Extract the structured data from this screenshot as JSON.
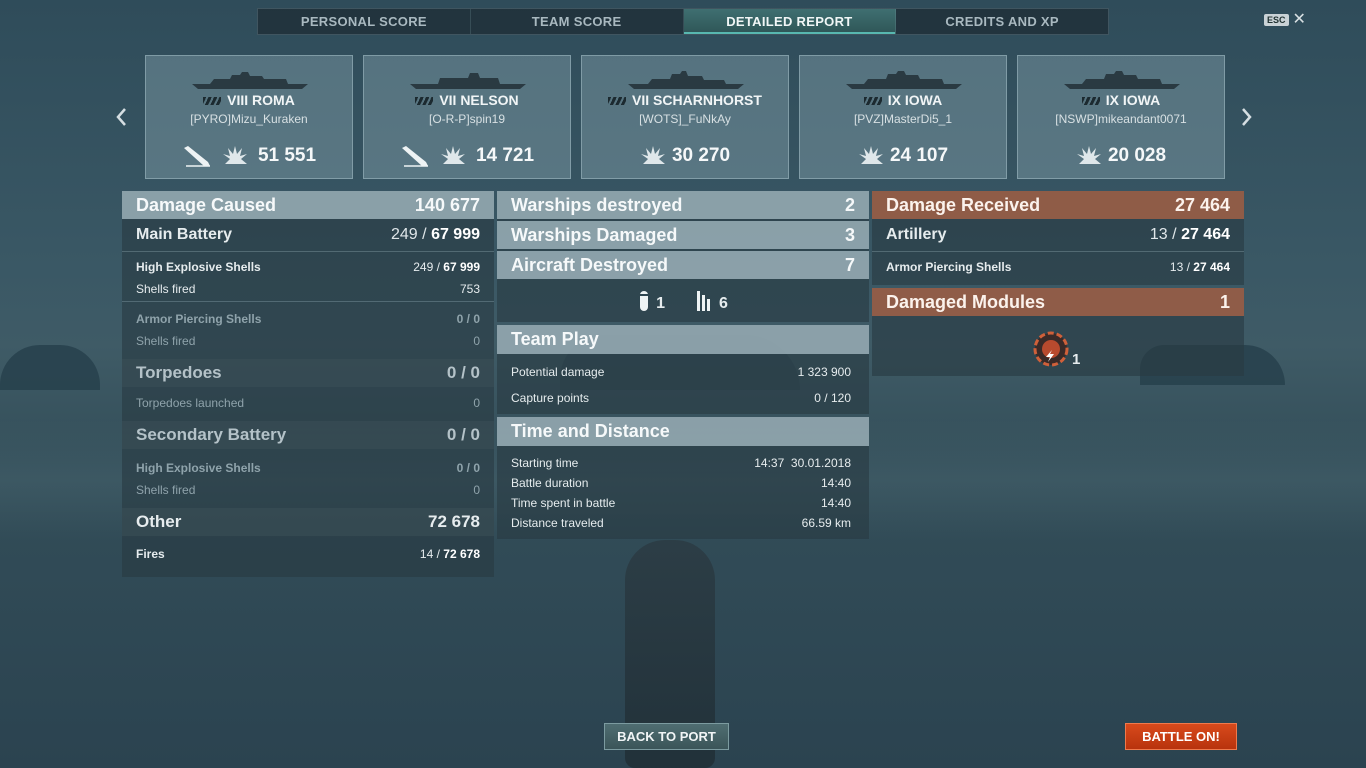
{
  "tabs": [
    "PERSONAL SCORE",
    "TEAM SCORE",
    "DETAILED REPORT",
    "CREDITS AND XP"
  ],
  "active_tab": 2,
  "esc_label": "ESC",
  "ships": [
    {
      "tier_name": "VIII ROMA",
      "player": "[PYRO]Mizu_Kuraken",
      "damage": "51 551",
      "sunk": true
    },
    {
      "tier_name": "VII NELSON",
      "player": "[O-R-P]spin19",
      "damage": "14 721",
      "sunk": true
    },
    {
      "tier_name": "VII SCHARNHORST",
      "player": "[WOTS]_FuNkAy",
      "damage": "30 270",
      "sunk": false
    },
    {
      "tier_name": "IX IOWA",
      "player": "[PVZ]MasterDi5_1",
      "damage": "24 107",
      "sunk": false
    },
    {
      "tier_name": "IX IOWA",
      "player": "[NSWP]mikeandant0071",
      "damage": "20 028",
      "sunk": false
    }
  ],
  "left": {
    "damage_caused": {
      "label": "Damage Caused",
      "value": "140 677"
    },
    "main_battery": {
      "label": "Main Battery",
      "hits": "249",
      "value": "67 999"
    },
    "main_he": {
      "label": "High Explosive Shells",
      "hits": "249",
      "value": "67 999"
    },
    "main_he_fired": {
      "label": "Shells fired",
      "value": "753"
    },
    "main_ap": {
      "label": "Armor Piercing Shells",
      "value": "0 / 0"
    },
    "main_ap_fired": {
      "label": "Shells fired",
      "value": "0"
    },
    "torpedoes": {
      "label": "Torpedoes",
      "value": "0 / 0"
    },
    "torpedoes_launched": {
      "label": "Torpedoes launched",
      "value": "0"
    },
    "secondary": {
      "label": "Secondary Battery",
      "value": "0 / 0"
    },
    "sec_he": {
      "label": "High Explosive Shells",
      "value": "0 / 0"
    },
    "sec_he_fired": {
      "label": "Shells fired",
      "value": "0"
    },
    "other": {
      "label": "Other",
      "value": "72 678"
    },
    "fires": {
      "label": "Fires",
      "hits": "14",
      "value": "72 678"
    }
  },
  "center": {
    "warships_destroyed": {
      "label": "Warships destroyed",
      "value": "2"
    },
    "warships_damaged": {
      "label": "Warships Damaged",
      "value": "3"
    },
    "aircraft_destroyed": {
      "label": "Aircraft Destroyed",
      "value": "7"
    },
    "aircraft_icons": [
      {
        "icon": "fighter-icon",
        "count": "1"
      },
      {
        "icon": "bomber-icon",
        "count": "6"
      }
    ],
    "team_play": {
      "label": "Team Play"
    },
    "potential_damage": {
      "label": "Potential damage",
      "value": "1 323 900"
    },
    "capture_points": {
      "label": "Capture points",
      "value": "0 / 120"
    },
    "time_distance": {
      "label": "Time and Distance"
    },
    "starting_time": {
      "label": "Starting time",
      "value": "14:37  30.01.2018"
    },
    "battle_duration": {
      "label": "Battle duration",
      "value": "14:40"
    },
    "time_spent": {
      "label": "Time spent in battle",
      "value": "14:40"
    },
    "distance": {
      "label": "Distance traveled",
      "value": "66.59 km"
    }
  },
  "right": {
    "damage_received": {
      "label": "Damage Received",
      "value": "27 464"
    },
    "artillery": {
      "label": "Artillery",
      "hits": "13",
      "value": "27 464"
    },
    "ap_shells": {
      "label": "Armor Piercing Shells",
      "hits": "13",
      "value": "27 464"
    },
    "damaged_modules": {
      "label": "Damaged Modules",
      "value": "1"
    },
    "module_icon": {
      "icon": "engine-module-icon",
      "count": "1"
    }
  },
  "buttons": {
    "back": "BACK TO PORT",
    "battle": "BATTLE ON!"
  },
  "colors": {
    "accent_teal": "#58b8b0",
    "orange_header": "#a0604a",
    "battle_button": "#c83c14"
  }
}
